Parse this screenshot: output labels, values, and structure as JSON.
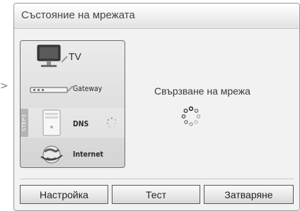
{
  "left_indicator": ">",
  "dialog": {
    "title": "Състояние на мрежата",
    "connecting_text": "Свързване на мрежа"
  },
  "status_panel": {
    "rows": [
      {
        "label": "TV",
        "icon": "tv-icon"
      },
      {
        "label": "Gateway",
        "icon": "router-icon"
      },
      {
        "label": "DNS",
        "icon": "server-icon",
        "step_tab": "STEP3",
        "active": true
      },
      {
        "label": "Internet",
        "icon": "globe-icon"
      }
    ]
  },
  "buttons": {
    "setup": "Настройка",
    "test": "Тест",
    "close": "Затваряне"
  },
  "colors": {
    "dialog_bg": "#f2f2f2",
    "panel_border": "#6f6f6f",
    "button_border": "#575757",
    "text": "#3a3a3a"
  }
}
